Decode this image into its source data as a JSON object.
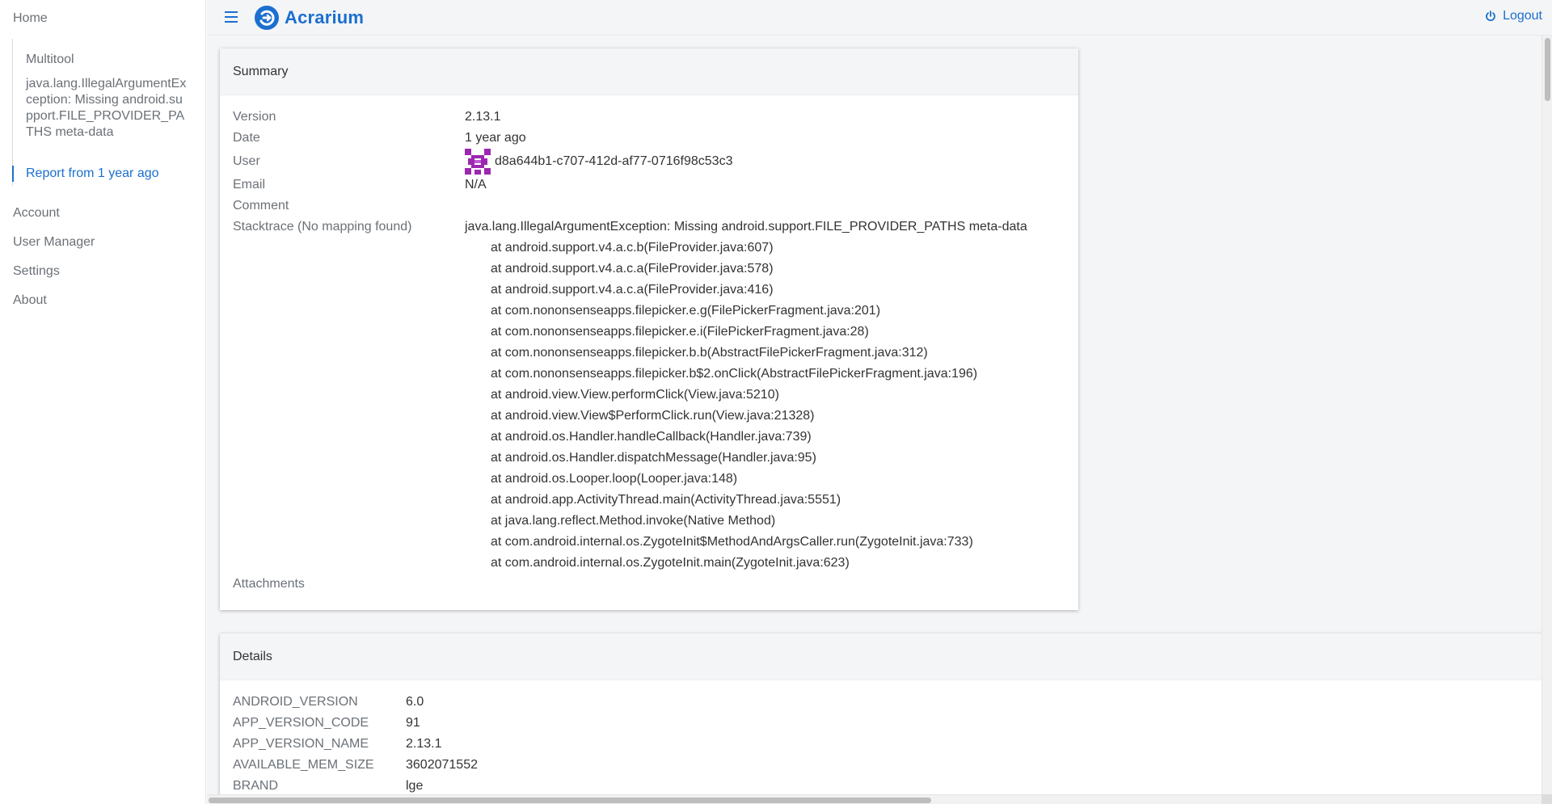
{
  "app": {
    "name": "Acrarium"
  },
  "topbar": {
    "logout_label": "Logout"
  },
  "sidebar": {
    "home": "Home",
    "subitems": {
      "app": "Multitool",
      "crash": "java.lang.IllegalArgumentException: Missing android.support.FILE_PROVIDER_PATHS meta-data",
      "report": "Report from 1 year ago"
    },
    "account": "Account",
    "user_manager": "User Manager",
    "settings": "Settings",
    "about": "About"
  },
  "summary": {
    "title": "Summary",
    "version_label": "Version",
    "version": "2.13.1",
    "date_label": "Date",
    "date": "1 year ago",
    "user_label": "User",
    "user": "d8a644b1-c707-412d-af77-0716f98c53c3",
    "email_label": "Email",
    "email": "N/A",
    "comment_label": "Comment",
    "comment": "",
    "stacktrace_label": "Stacktrace (No mapping found)",
    "stacktrace_head": "java.lang.IllegalArgumentException: Missing android.support.FILE_PROVIDER_PATHS meta-data",
    "stacktrace_lines": [
      "at android.support.v4.a.c.b(FileProvider.java:607)",
      "at android.support.v4.a.c.a(FileProvider.java:578)",
      "at android.support.v4.a.c.a(FileProvider.java:416)",
      "at com.nononsenseapps.filepicker.e.g(FilePickerFragment.java:201)",
      "at com.nononsenseapps.filepicker.e.i(FilePickerFragment.java:28)",
      "at com.nononsenseapps.filepicker.b.b(AbstractFilePickerFragment.java:312)",
      "at com.nononsenseapps.filepicker.b$2.onClick(AbstractFilePickerFragment.java:196)",
      "at android.view.View.performClick(View.java:5210)",
      "at android.view.View$PerformClick.run(View.java:21328)",
      "at android.os.Handler.handleCallback(Handler.java:739)",
      "at android.os.Handler.dispatchMessage(Handler.java:95)",
      "at android.os.Looper.loop(Looper.java:148)",
      "at android.app.ActivityThread.main(ActivityThread.java:5551)",
      "at java.lang.reflect.Method.invoke(Native Method)",
      "at com.android.internal.os.ZygoteInit$MethodAndArgsCaller.run(ZygoteInit.java:733)",
      "at com.android.internal.os.ZygoteInit.main(ZygoteInit.java:623)"
    ],
    "attachments_label": "Attachments"
  },
  "details": {
    "title": "Details",
    "rows": [
      {
        "key": "ANDROID_VERSION",
        "value": "6.0"
      },
      {
        "key": "APP_VERSION_CODE",
        "value": "91"
      },
      {
        "key": "APP_VERSION_NAME",
        "value": "2.13.1"
      },
      {
        "key": "AVAILABLE_MEM_SIZE",
        "value": "3602071552"
      },
      {
        "key": "BRAND",
        "value": "lge"
      }
    ]
  },
  "colors": {
    "accent": "#1b6fcf",
    "avatar": "#9c27b0"
  }
}
